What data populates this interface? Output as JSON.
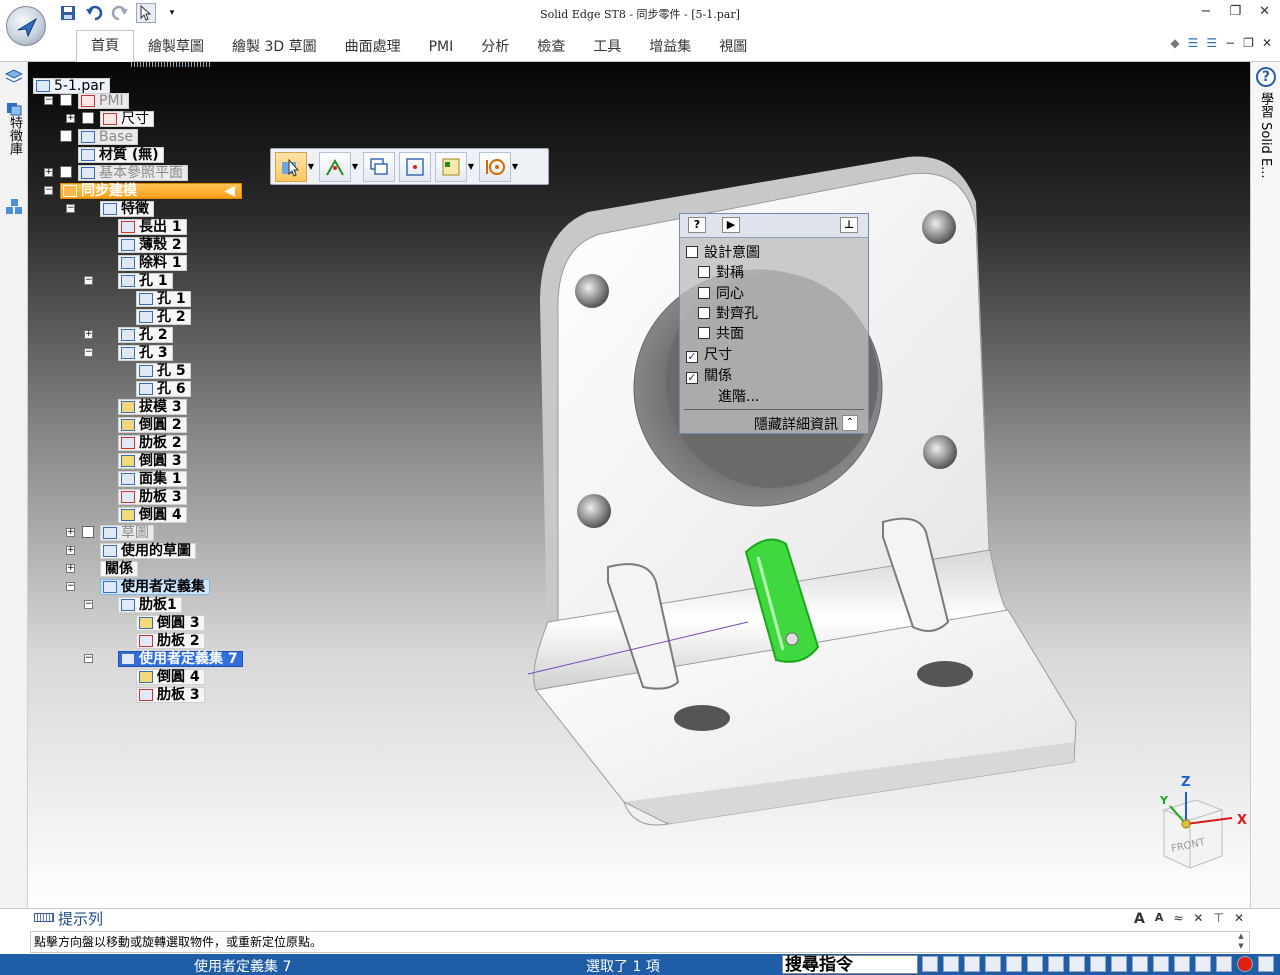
{
  "window": {
    "title": "Solid Edge ST8 - 同步零件 - [5-1.par]",
    "controls": [
      "−",
      "❐",
      "✕"
    ]
  },
  "ribbon": {
    "tabs": [
      "首頁",
      "繪製草圖",
      "繪製 3D 草圖",
      "曲面處理",
      "PMI",
      "分析",
      "檢查",
      "工具",
      "增益集",
      "視圖"
    ],
    "active_tab": "首頁",
    "right_controls": [
      "−",
      "❐",
      "✕"
    ]
  },
  "left_tabs": {
    "feature_library": "特徵庫"
  },
  "right_tabs": {
    "help": "?",
    "learn": "學習 Solid E..."
  },
  "tree": {
    "root": "5-1.par",
    "pmi": "PMI",
    "dims": "尺寸",
    "base": "Base",
    "material": "材質 (無)",
    "ref_planes": "基本參照平面",
    "sync": "同步建模",
    "features": "特徵",
    "extrude1": "長出 1",
    "thin1": "薄殼 2",
    "cut1": "除料 1",
    "hole1": "孔 1",
    "hole1a": "孔 1",
    "hole1b": "孔 2",
    "hole2": "孔 2",
    "hole3": "孔 3",
    "hole5": "孔 5",
    "hole6": "孔 6",
    "draft3": "拔模 3",
    "round2": "倒圓 2",
    "rib2": "肋板 2",
    "round3": "倒圓 3",
    "faceset1": "面集 1",
    "rib3": "肋板 3",
    "round4": "倒圓 4",
    "sketch": "草圖",
    "used_sketch": "使用的草圖",
    "relations": "關係",
    "user_sets": "使用者定義集",
    "rib1": "肋板1",
    "us_round3": "倒圓 3",
    "us_rib2": "肋板 2",
    "user_set7": "使用者定義集 7",
    "us7_round4": "倒圓 4",
    "us7_rib3": "肋板 3"
  },
  "design_intent": {
    "items": [
      {
        "label": "設計意圖",
        "checked": false
      },
      {
        "label": "對稱",
        "checked": false
      },
      {
        "label": "同心",
        "checked": false
      },
      {
        "label": "對齊孔",
        "checked": false
      },
      {
        "label": "共面",
        "checked": false
      },
      {
        "label": "尺寸",
        "checked": true
      },
      {
        "label": "關係",
        "checked": true
      }
    ],
    "advanced": "進階...",
    "hide_details": "隱藏詳細資訊"
  },
  "viewcube": {
    "x": "X",
    "y": "Y",
    "z": "Z",
    "face": "FRONT"
  },
  "prompt": {
    "title": "提示列",
    "text": "點擊方向盤以移動或旋轉選取物件，或重新定位原點。",
    "tools": [
      "A",
      "A",
      "≈",
      "✕",
      "⊤",
      "✕"
    ]
  },
  "status": {
    "selection": "使用者定義集 7",
    "count": "選取了 1 項",
    "search": "搜尋指令"
  },
  "colors": {
    "status_bar": "#1f5da6",
    "highlight_green": "#3fd93f",
    "tree_select_orange": "#ffa81a",
    "tree_select_blue": "#2f6fe0"
  }
}
